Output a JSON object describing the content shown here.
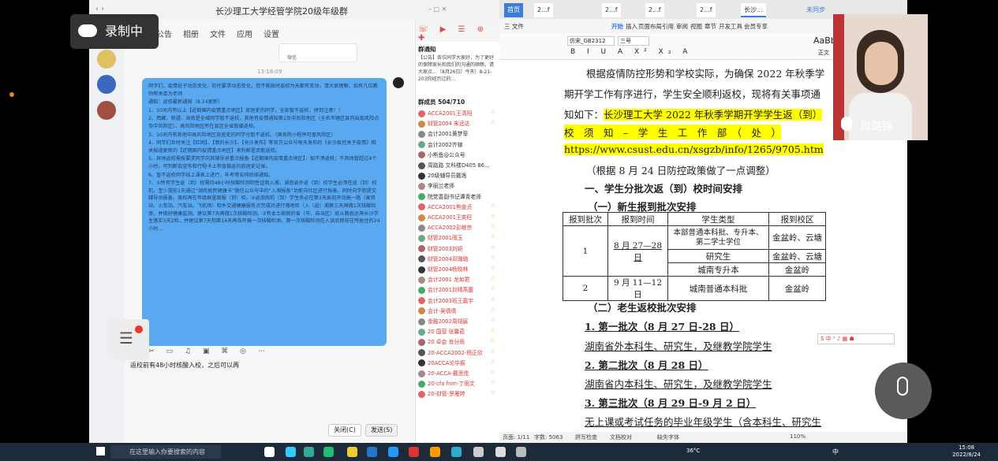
{
  "chat_app": {
    "title": "长沙理工大学经管学院20级年级群",
    "menu": [
      "公告",
      "相册",
      "文件",
      "应用",
      "设置"
    ],
    "time": "13:18:09",
    "notice_header": "群通知",
    "notice_text": "【公告】各位同学大家好，为了更好的保障家长和我们的沟通的顺畅，请大家点…（8月26日）今天）8-21-203你经历过的…",
    "small_card_label": "微信",
    "message": [
      "同学们，疫情处于动态变化，防控要求动态变化，您不能按时返校为天都有变动，请大家理解，如有几位教师帮关单为老师",
      "通知：返校最新通知（8.24更新）",
      "1、10天内有以上【近期国内疫情重点地区】旅居史的同学，全部暂不返校，拼到注意！！",
      "2、西藏、新疆、海南是全域同学暂不返校，其他有疫情通知第1及中风险地区（全名市辖区县内出现风险点及中风险区）、高风险地区所在县区全省暂缓返校。",
      "3、10天内有其他中高风险地区旅居史的同学也暂不返校。（国务院小程序可查风险区）",
      "4、同学们及时关注【红网】、【我的长沙】、【长沙发布】等官方公众号每天发布的《长沙疾控关于疫情》相关报道更新的【近期国内疫情重点地区】来判断是否能返校。",
      "5、异地返校需按要求同学向其辅导员重点报备【近期国内疫情重点地区】，如不须返校；不具体暂超过4个小时，可判断会宣布和行程卡上有值做返的旅居史记录。",
      "6、暂不返校同学线上课表上进行，补考等安排后续通知。",
      "7、①所有学生返（到）校需持48小时核酸检测阴性证明入湘，湖南省外返（到）校学生必须在返（到）校前，至少提前1天通过“湖南居民健康卡”微信公众号中的“入湘报备”功能向社区进行报备，同时向学院提交辅导员报备。离校再在年级群里面报（到）校。②返湖南前（到）学生务必在第3天乘前开动高一路（高铁站、火车站、汽车站、飞机场）和乡交通健康服务点完成对进行落地检（入（返）湘第三天再做1次核酸检测，并做好健康监测。建议第7天再做1次核酸检测。③有本土病例的省（市、自治区）就从路抵达来长沙学生落实3天2检，并建议第7天和第14天再各开展一次核酸检测，第一次核酸检测在入读后即前往所居住的24小时…"
    ],
    "input_text": "返校前有48小时核酸入校，之后可以再",
    "close_btn": "关闭(C)",
    "send_btn": "发送(S)",
    "members_header": "群成员 504/710",
    "members": [
      {
        "n": "ACCA2001王清阳",
        "red": true
      },
      {
        "n": "财管2004 朱远达",
        "red": true
      },
      {
        "n": "会计2001黄梦菲",
        "red": false
      },
      {
        "n": "会计2002齐棣",
        "red": false
      },
      {
        "n": "小熊鱼@公众号",
        "red": false
      },
      {
        "n": "周路路 文科楼D405 86…",
        "red": false
      },
      {
        "n": "20级辅导员戴逸",
        "red": false
      },
      {
        "n": "李丽兰老师",
        "red": false
      },
      {
        "n": "院党委副书记谭青老师",
        "red": false
      },
      {
        "n": "ACCA2001熊金贞",
        "red": true
      },
      {
        "n": "ACCA2001王奕旺",
        "red": true
      },
      {
        "n": "ACCA2002彭继宗",
        "red": true
      },
      {
        "n": "财管2001雨玉",
        "red": true
      },
      {
        "n": "财管2003刘妍",
        "red": true
      },
      {
        "n": "财管2004邓璐璐",
        "red": true
      },
      {
        "n": "财管2004杨晓林",
        "red": true
      },
      {
        "n": "会计2001 龙如君",
        "red": true
      },
      {
        "n": "会计2001刘晴燕蕾",
        "red": true
      },
      {
        "n": "会计2003班王嘉宇",
        "red": true
      },
      {
        "n": "会计-吴倩倩",
        "red": true
      },
      {
        "n": "金融2002周翊宸",
        "red": true
      },
      {
        "n": "20 国营 张馨茹",
        "red": true
      },
      {
        "n": "20 卓会 肖分雨",
        "red": true
      },
      {
        "n": "20-ACCA2002-杨正欣",
        "red": true
      },
      {
        "n": "20ACCA论华振",
        "red": true
      },
      {
        "n": "20-ACCA-戴思佳",
        "red": true
      },
      {
        "n": "20-cfa fnm-丁雨文",
        "red": true
      },
      {
        "n": "20-财管-罗雁婷",
        "red": true
      }
    ]
  },
  "recording": {
    "label": "录制中"
  },
  "wps": {
    "tabs": [
      "首页",
      "2...f",
      "2...f",
      "2...f",
      "2...f",
      "长沙..."
    ],
    "login": "未同步",
    "menu": [
      "三 文件",
      "开始",
      "插入",
      "页面布局",
      "引用",
      "审阅",
      "视图",
      "章节",
      "开发工具",
      "会员专享"
    ],
    "font_name": "仿宋_GB2312",
    "font_size": "三号",
    "style_sample": "AaBb",
    "style_label": "正文",
    "doc_lines": {
      "l1": "根据疫情防控形势和学校实际，为确保 2022 年秋季学",
      "l2": "期开学工作有序进行，学生安全顺利返校，现将有关事项通",
      "l3a": "知如下：",
      "l3b": "长沙理工大学 2022 年秋季学期开学学生返（到）",
      "l4": "校　须　知　–　学　生　工　作　部　（　处　）",
      "l4b": "-",
      "l5": "https://www.csust.edu.cn/xsgzb/info/1265/9705.htm",
      "l6": "（根据 8 月 24 日防控政策做了一点调整）",
      "h1": "一、学生分批次返（到）校时间安排",
      "h2": "（一）新生报到批次安排",
      "h3": "（二）老生返校批次安排",
      "b1": "1. 第一批次（8 月 27 日-28 日）",
      "b1t": "湖南省外本科生、研究生，及继教学院学生",
      "b2": "2. 第二批次（8 月 28 日）",
      "b2t": "湖南省内本科生、研究生，及继教学院学生",
      "b3": "3. 第三批次（8 月 29 日-9 月 2 日）",
      "b3t": "无上课或考试任务的毕业年级学生（含本科生、研究生"
    },
    "table": {
      "headers": [
        "报到批次",
        "报到时间",
        "学生类型",
        "报到校区"
      ],
      "rows": [
        [
          "1",
          "8 月 27—28 日",
          "本部普通本科批、专升本、第二学士学位",
          "金盆岭、云塘"
        ],
        [
          "",
          "",
          "研究生",
          "金盆岭、云塘"
        ],
        [
          "",
          "",
          "城南专升本",
          "金盆岭"
        ],
        [
          "2",
          "9 月 11—12 日",
          "城南普通本科批",
          "金盆岭"
        ]
      ]
    },
    "status": {
      "page": "页面: 1/11",
      "words": "字数: 5063",
      "spell": "拼写检查",
      "compat": "文档校对",
      "missing": "缺失字体",
      "zoom": "110%"
    }
  },
  "video": {
    "name": "周路路"
  },
  "ime": {
    "text": "中"
  },
  "taskbar": {
    "search": "在这里输入你要搜索的内容",
    "time": "15:08",
    "date": "2022/8/24",
    "weather": "36°C",
    "lang": "中"
  }
}
